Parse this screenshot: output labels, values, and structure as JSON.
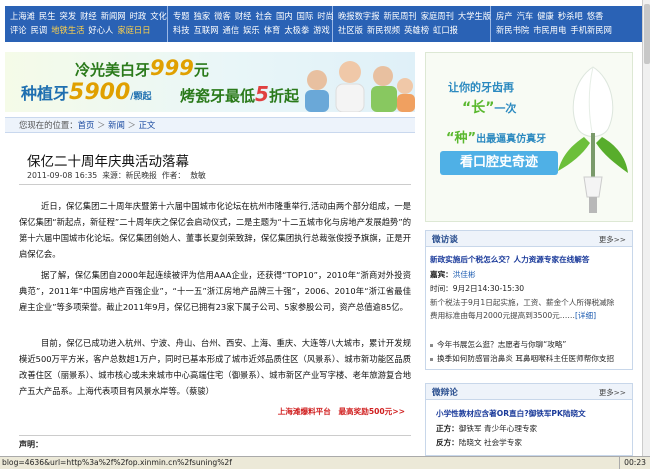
{
  "nav": {
    "group1": {
      "row1": [
        "上海滩",
        "民生",
        "突发",
        "财经",
        "新闻网",
        "时政",
        "文化"
      ],
      "row2": [
        "评论",
        "民调",
        "地铁生活",
        "好心人",
        "家庭日日"
      ]
    },
    "group2": {
      "row1": [
        "专题",
        "独家",
        "微客",
        "财经",
        "社会",
        "国内",
        "国际",
        "时尚"
      ],
      "row2": [
        "科技",
        "互联网",
        "通信",
        "娱乐",
        "体育",
        "太极拳",
        "游戏"
      ]
    },
    "group3": {
      "row1": [
        "晚报数字报",
        "新民周刊",
        "家庭周刊",
        "大学生版"
      ],
      "row2": [
        "社区版",
        "新民视频",
        "英雄榜",
        "虹口报"
      ]
    },
    "group4": {
      "row1": [
        "房产",
        "汽车",
        "健康",
        "秒杀吧",
        "悠香"
      ],
      "row2": [
        "新民书院",
        "市民用电",
        "手机新民网"
      ]
    }
  },
  "banner": {
    "line1_prefix": "冷光美白牙",
    "line1_price": "999",
    "line1_unit": "元",
    "line2_prefix": "种植牙",
    "line2_price": "5900",
    "line2_unit": "/颗起",
    "line3_prefix": "烤瓷牙最低",
    "line3_price": "5",
    "line3_unit": "折起"
  },
  "right_ad": {
    "line1": "让你的牙齿再",
    "line2_a": "“长”",
    "line2_b": "一次",
    "line3_a": "“种”",
    "line3_b": "出最逼真仿真牙",
    "line4": "看口腔史奇迹"
  },
  "breadcrumb": {
    "label": "您现在的位置：",
    "items": [
      "首页",
      "新闻",
      "正文"
    ],
    "sep": "＞"
  },
  "article": {
    "title": "保亿二十周年庆典活动落幕",
    "datetime": "2011-09-08 16:35",
    "source": "来源：新民晚报",
    "author": "作者：",
    "editor": "敖敏",
    "paragraphs": [
      "近日，保亿集团二十周年庆暨第十六届中国城市化论坛在杭州市隆重举行,活动由两个部分组成，一是保亿集团“新起点，新征程”二十周年庆之保亿会启动仪式，二是主题为“十二五城市化与房地产发展趋势”的第十六届中国城市化论坛。保亿集团创始人、董事长夏剑荣致辞，保亿集团执行总裁张俊授予旗旗，正是开启保亿会。",
      "据了解，保亿集团自2000年起连续被评为信用AAA企业，还获得“TOP10”，2010年“浙商对外投资典范”，2011年“中国房地产百强企业”，“十一五”浙江房地产品牌三十强”，2006、2010年“浙江省最佳雇主企业”等多项荣誉。截止2011年9月，保亿已拥有23家下属子公司、5家参股公司，资产总值逾85亿。",
      "目前，保亿已成功进入杭州、宁波、舟山、台州、西安、上海、重庆、大连等八大城市，累计开发规模近500万平方米，客户总数超1万户，同时已基本形成了城市近郊品质住区（风景系）、城市新功能区品质改善住区（丽景系）、城市核心或未来城市中心高端住宅（御景系）、城市新区产业写字楼、老年旅游复合地产五大产品系。上海代表项目有风景水岸等。（蔡骏）"
    ],
    "ad_link": "上海滩爆料平台　最高奖励500元>>",
    "declaration": "声明："
  },
  "panel_a": {
    "title": "微访谈",
    "more": "更多>>",
    "headline": "新政实施后个税怎么交？人力资源专家在线解答",
    "guest_label": "嘉宾：",
    "guest_name": "洪佳彬",
    "time": "时间：9月2日14:30-15:30",
    "desc1": "新个税法于9月1日起实施，工资、薪金个人所得税减除",
    "desc2": "费用标准由每月2000元提高到3500元……",
    "desc_more": "[详细]",
    "item1": "今年书展怎么逛？志愿者与你聊“攻略”",
    "item2": "换季如何防感冒治鼻炎 耳鼻咽喉科主任医师帮你支招"
  },
  "panel_b": {
    "title": "微辩论",
    "more": "更多>>",
    "headline": "小学性教材应含著OR直白?御铁军PK陆晓文",
    "pro_label": "正方：",
    "pro": "御铁军 青少年心理专家",
    "con_label": "反方：",
    "con": "陆晓文 社会学专家"
  },
  "status": {
    "url": "blog=4636&url=http%3a%2f%2fop.xinmin.cn%2fsuning%2f",
    "time": "00:23"
  },
  "colors": {
    "nav_bg": "#2a62b5",
    "accent_red": "#d02020",
    "link_blue": "#1a4aa0"
  }
}
